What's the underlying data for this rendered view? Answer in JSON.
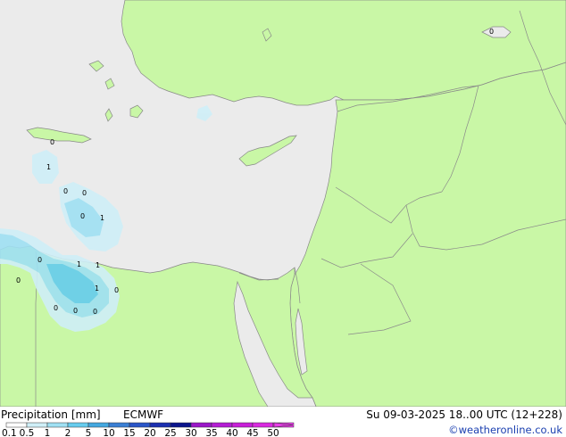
{
  "footer": {
    "title": "Precipitation [mm]",
    "model": "ECMWF",
    "valid_time": "Su 09-03-2025 18..00 UTC (12+228)",
    "credit": "©weatheronline.co.uk"
  },
  "legend": {
    "ticks": [
      "0.1",
      "0.5",
      "1",
      "2",
      "5",
      "10",
      "15",
      "20",
      "25",
      "30",
      "35",
      "40",
      "45",
      "50"
    ],
    "colors": [
      "#ffffff",
      "#cfeff8",
      "#9fe0f3",
      "#66ccee",
      "#44a8e0",
      "#3b7fd4",
      "#2a55c8",
      "#1b2fb0",
      "#0b148c",
      "#9a16c8",
      "#b41cd4",
      "#c81fd8",
      "#d92ae0",
      "#e83ce8"
    ]
  },
  "map": {
    "land_color": "#c9f7a6",
    "sea_color": "#ebebeb",
    "border_color": "#8a8a8a",
    "precip_labels": [
      "0",
      "1",
      "0",
      "0",
      "0",
      "1",
      "0",
      "1",
      "1",
      "0",
      "1",
      "0",
      "0",
      "0",
      "0",
      "0"
    ]
  }
}
